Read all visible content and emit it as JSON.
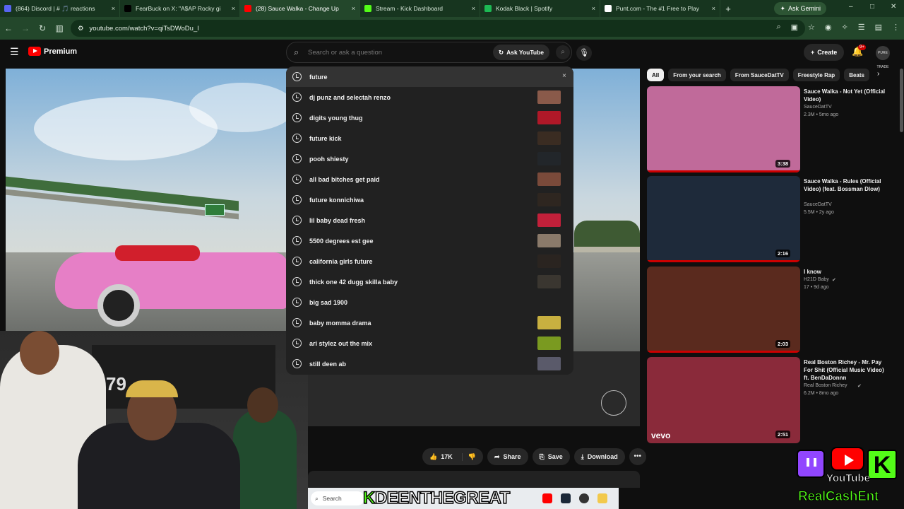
{
  "browser": {
    "tabs": [
      {
        "label": "(864) Discord | # 🎵 reactions",
        "color": "#5865f2",
        "active": false
      },
      {
        "label": "FearBuck on X: \"A$AP Rocky gi",
        "color": "#000000",
        "active": false
      },
      {
        "label": "(28) Sauce Walka - Change Up",
        "color": "#ff0000",
        "active": true
      },
      {
        "label": "Stream - Kick Dashboard",
        "color": "#53fc18",
        "active": false
      },
      {
        "label": "Kodak Black | Spotify",
        "color": "#1db954",
        "active": false
      },
      {
        "label": "Punt.com - The #1 Free to Play",
        "color": "#ffffff",
        "active": false
      }
    ],
    "tab_close": "×",
    "new_tab": "+",
    "ask_gemini": "Ask Gemini",
    "url": "youtube.com/watch?v=qiTsDWoDu_I",
    "window_controls": [
      "–",
      "□",
      "✕"
    ]
  },
  "youtube": {
    "logo_text": "Premium",
    "search": {
      "placeholder": "Search or ask a question",
      "value": ""
    },
    "ask_youtube": "Ask YouTube",
    "create": "Create",
    "notification_count": "9+",
    "avatar_text": "PURE TRADE"
  },
  "suggestions": [
    {
      "text": "future",
      "thumb": null,
      "close": "×"
    },
    {
      "text": "dj punz and selectah renzo",
      "thumb": "#8a5a4a"
    },
    {
      "text": "digits young thug",
      "thumb": "#b01828"
    },
    {
      "text": "future kick",
      "thumb": "#3a2c22"
    },
    {
      "text": "pooh shiesty",
      "thumb": "#22262a"
    },
    {
      "text": "all bad bitches get paid",
      "thumb": "#7a4a3a"
    },
    {
      "text": "future konnichiwa",
      "thumb": "#2e2620"
    },
    {
      "text": "lil baby dead fresh",
      "thumb": "#c2203a"
    },
    {
      "text": "5500 degrees est gee",
      "thumb": "#8a7a6a"
    },
    {
      "text": "california girls future",
      "thumb": "#2a2420"
    },
    {
      "text": "thick one 42 dugg skilla baby",
      "thumb": "#3a3630"
    },
    {
      "text": "big sad 1900",
      "thumb": null
    },
    {
      "text": "baby momma drama",
      "thumb": "#c8b040"
    },
    {
      "text": "ari stylez out the mix",
      "thumb": "#7a9a20"
    },
    {
      "text": "still deen ab",
      "thumb": "#5a5a6a"
    }
  ],
  "actions": {
    "likes": "17K",
    "share": "Share",
    "save": "Save",
    "download": "Download",
    "more": "•••"
  },
  "chips": [
    "All",
    "From your search",
    "From SauceDatTV",
    "Freestyle Rap",
    "Beats"
  ],
  "recommendations": [
    {
      "title": "Sauce Walka - Not Yet (Official Video)",
      "channel": "SauceDatTV",
      "meta": "2.3M • 5mo ago",
      "duration": "3:38",
      "thumb": "#c06a9a",
      "verified": false,
      "overlay": ""
    },
    {
      "title": "Sauce Walka - Rules (Official Video) (feat. Bossman Dlow)",
      "channel": "SauceDatTV",
      "meta": "5.5M • 2y ago",
      "duration": "2:16",
      "thumb": "#1e2a3a",
      "verified": false,
      "overlay": ""
    },
    {
      "title": "I know",
      "channel": "H21D Baby",
      "meta": "17 • 9d ago",
      "duration": "2:03",
      "thumb": "#5a2a1e",
      "verified": true,
      "overlay": ""
    },
    {
      "title": "Real Boston Richey - Mr. Pay For Shit (Official Music Video) ft. BenDaDonnn",
      "channel": "Real Boston Richey",
      "meta": "6.2M • 8mo ago",
      "duration": "2:51",
      "thumb": "#8a2a3a",
      "verified": true,
      "overlay": "vevo"
    }
  ],
  "taskbar": {
    "search": "Search",
    "streamer_k": "K",
    "streamer_name": "DEENTHEGREAT"
  },
  "branding": {
    "youtube_word": "YouTube",
    "k_letter": "K",
    "name": "RealCashEnt"
  },
  "video": {
    "pc_number": "79"
  }
}
